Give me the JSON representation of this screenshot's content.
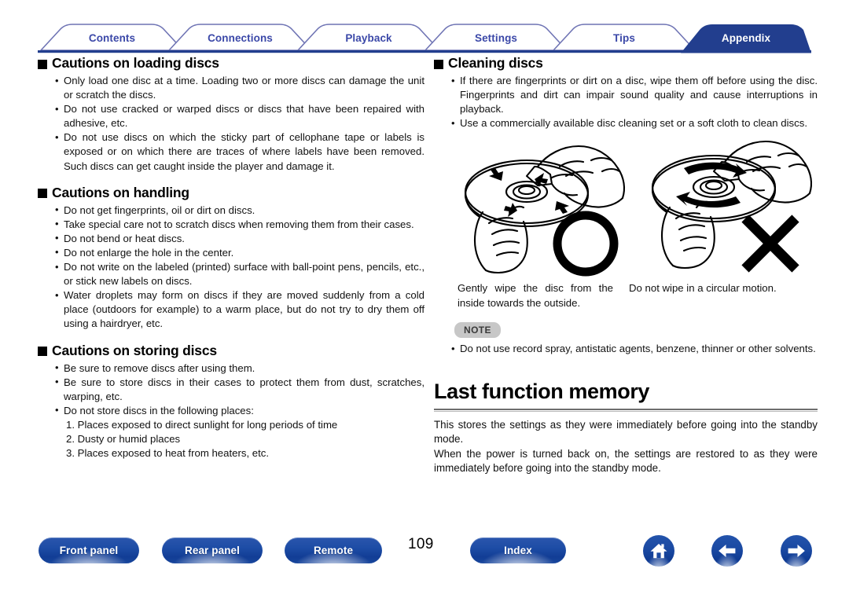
{
  "nav_tabs": [
    {
      "label": "Contents",
      "active": false
    },
    {
      "label": "Connections",
      "active": false
    },
    {
      "label": "Playback",
      "active": false
    },
    {
      "label": "Settings",
      "active": false
    },
    {
      "label": "Tips",
      "active": false
    },
    {
      "label": "Appendix",
      "active": true
    }
  ],
  "colors": {
    "tab_active_fill": "#223e8e",
    "tab_inactive_stroke": "#6f74b4",
    "tab_inactive_text": "#3b48a8",
    "tab_rule": "#223e8e",
    "note_badge_bg": "#c7c7c7",
    "note_badge_text": "#3a3a3a",
    "button_blue": "#1d4ca5",
    "heading_rule": "#6e6e6e"
  },
  "left_column": {
    "sections": [
      {
        "heading": "Cautions on loading discs",
        "bullet_icon": "black-square-icon",
        "items": [
          "Only load one disc at a time. Loading two or more discs can damage the unit or scratch the discs.",
          "Do not use cracked or warped discs or discs that have been repaired with adhesive, etc.",
          "Do not use discs on which the sticky part of cellophane tape or labels is exposed or on which there are traces of where labels have been removed. Such discs can get caught inside the player and damage it."
        ]
      },
      {
        "heading": "Cautions on handling",
        "bullet_icon": "black-square-icon",
        "items": [
          "Do not get fingerprints, oil or dirt on discs.",
          "Take special care not to scratch discs when removing them from their cases.",
          "Do not bend or heat discs.",
          "Do not enlarge the hole in the center.",
          "Do not write on the labeled (printed) surface with ball-point pens, pencils, etc., or stick new labels on discs.",
          "Water droplets may form on discs if they are moved suddenly from a cold place (outdoors for example) to a warm place, but do not try to dry them off using a hairdryer, etc."
        ]
      },
      {
        "heading": "Cautions on storing discs",
        "bullet_icon": "black-square-icon",
        "items": [
          "Be sure to remove discs after using them.",
          "Be sure to store discs in their cases to protect them from dust, scratches, warping, etc.",
          "Do not store discs in the following places:"
        ],
        "numbered_items": [
          "1. Places exposed to direct sunlight for long periods of time",
          "2. Dusty or humid places",
          "3. Places exposed to heat from heaters, etc."
        ]
      }
    ]
  },
  "right_column": {
    "cleaning_section": {
      "heading": "Cleaning discs",
      "bullet_icon": "black-square-icon",
      "items": [
        "If there are fingerprints or dirt on a disc, wipe them off before using the disc. Fingerprints and dirt can impair sound quality and cause interruptions in playback.",
        "Use a commercially available disc cleaning set or a soft cloth to clean discs."
      ]
    },
    "illustrations": {
      "left_figure": {
        "icon": "hand-wiping-disc-radially-illustration",
        "marker": "circle-ok-icon",
        "caption": "Gently wipe the disc from the inside towards the outside."
      },
      "right_figure": {
        "icon": "hand-wiping-disc-circularly-illustration",
        "marker": "cross-ng-icon",
        "caption": "Do not wipe in a circular motion."
      }
    },
    "note": {
      "badge": "NOTE",
      "items": [
        "Do not use record spray, antistatic agents, benzene, thinner or other solvents."
      ]
    },
    "last_function_memory": {
      "heading": "Last function memory",
      "paragraphs": [
        "This stores the settings as they were immediately before going into the standby mode.",
        "When the power is turned back on, the settings are restored to as they were immediately before going into the standby mode."
      ]
    }
  },
  "footer": {
    "buttons": [
      {
        "label": "Front panel"
      },
      {
        "label": "Rear panel"
      },
      {
        "label": "Remote"
      },
      {
        "label": "Index"
      }
    ],
    "page_number": "109",
    "icon_buttons": [
      {
        "icon": "home-icon"
      },
      {
        "icon": "arrow-left-icon"
      },
      {
        "icon": "arrow-right-icon"
      }
    ]
  }
}
